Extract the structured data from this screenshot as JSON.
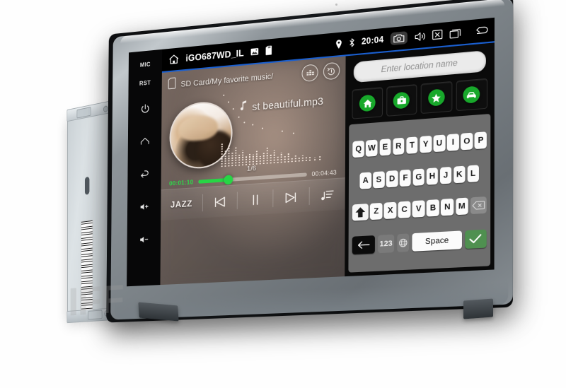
{
  "device": {
    "name": "double-din-android-car-head-unit",
    "hardkeys": [
      {
        "id": "mic",
        "label": "MIC",
        "type": "text"
      },
      {
        "id": "rst",
        "label": "RST",
        "type": "text"
      },
      {
        "id": "power",
        "label": "power-icon",
        "type": "icon"
      },
      {
        "id": "home",
        "label": "home-icon",
        "type": "icon"
      },
      {
        "id": "back",
        "label": "back-icon",
        "type": "icon"
      },
      {
        "id": "volup",
        "label": "volume-up-icon",
        "type": "icon"
      },
      {
        "id": "voldown",
        "label": "volume-down-icon",
        "type": "icon"
      }
    ]
  },
  "statusbar": {
    "home_icon": "home-icon",
    "title": "iGO687WD_IL",
    "picture_icon": "gallery-icon",
    "sdcard_icon": "sdcard-icon",
    "gps_icon": "location-pin-icon",
    "bluetooth_icon": "bluetooth-icon",
    "time": "20:04",
    "camera_icon": "camera-icon",
    "volume_icon": "volume-icon",
    "close_icon": "close-box-icon",
    "recents_icon": "recents-icon",
    "back_icon": "back-arrow-icon",
    "accent_color": "#1a5fd0"
  },
  "music": {
    "path": "SD Card/My favorite music/",
    "sdcard_icon": "sdcard-icon",
    "equalizer_icon": "equalizer-icon",
    "repeat_icon": "repeat-icon",
    "note_icon": "music-note-icon",
    "track_name": "st beautiful.mp3",
    "track_index": "1/6",
    "time_current": "00:01:10",
    "time_total": "00:04:43",
    "progress_percent": 28,
    "progress_color": "#27d645",
    "eq_preset": "JAZZ",
    "controls": [
      {
        "id": "previous",
        "icon": "previous-track-icon"
      },
      {
        "id": "pause",
        "icon": "pause-icon"
      },
      {
        "id": "next",
        "icon": "next-track-icon"
      },
      {
        "id": "playlist",
        "icon": "playlist-icon"
      }
    ],
    "album_art": "album-art-photo"
  },
  "navigation": {
    "search_placeholder": "Enter location name",
    "search_value": "",
    "favorites": [
      {
        "id": "home",
        "icon": "home-icon",
        "color": "#18a82b"
      },
      {
        "id": "work",
        "icon": "briefcase-icon",
        "color": "#18a82b"
      },
      {
        "id": "favorite",
        "icon": "star-icon",
        "color": "#18a82b"
      },
      {
        "id": "car",
        "icon": "car-icon",
        "color": "#18a82b"
      }
    ],
    "keyboard": {
      "row1": [
        "Q",
        "W",
        "E",
        "R",
        "T",
        "Y",
        "U",
        "I",
        "O",
        "P"
      ],
      "row2": [
        "A",
        "S",
        "D",
        "F",
        "G",
        "H",
        "J",
        "K",
        "L"
      ],
      "row3_shift": "shift-icon",
      "row3": [
        "Z",
        "X",
        "C",
        "V",
        "B",
        "N",
        "M"
      ],
      "row3_backspace": "backspace-icon",
      "row4": {
        "back": "back-arrow-icon",
        "numbers": "123",
        "language": "globe-icon",
        "space": "Space",
        "confirm": "checkmark-icon",
        "confirm_color": "#4f9050"
      }
    }
  },
  "watermark": {
    "text": "IFF"
  }
}
